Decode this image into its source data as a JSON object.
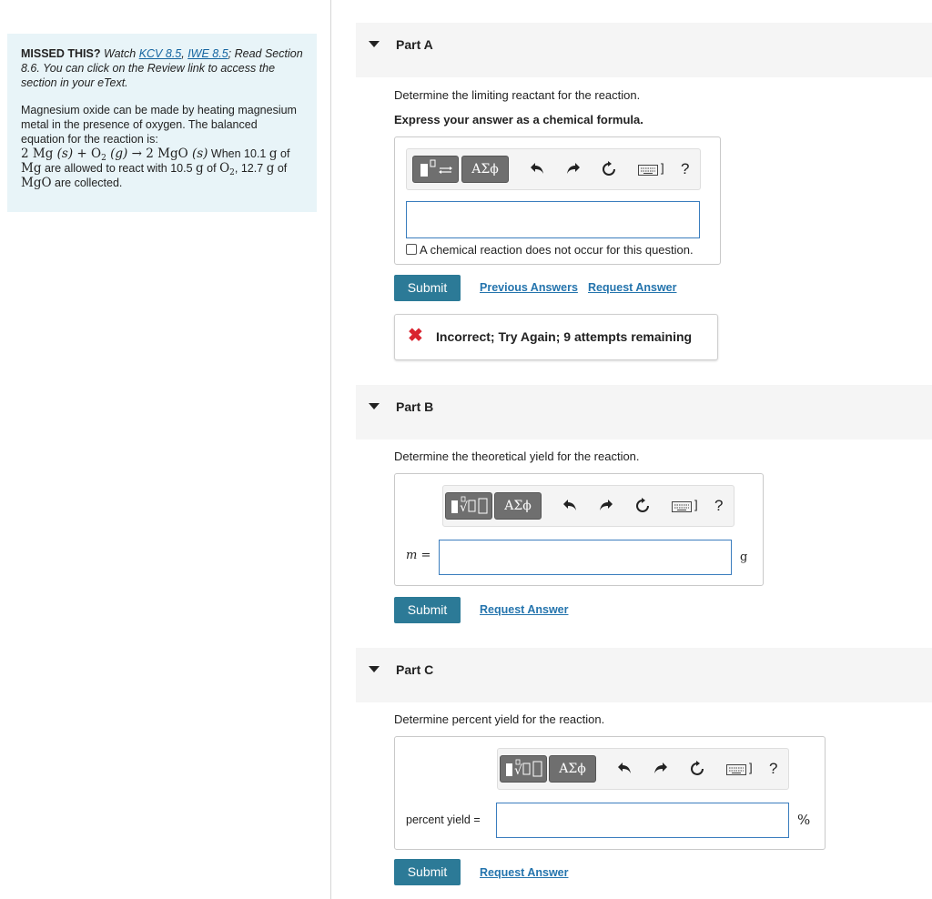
{
  "intro": {
    "missed_label": "MISSED THIS?",
    "missed_watch": "Watch",
    "kcv_link": "KCV 8.5",
    "iwe_link": "IWE 8.5",
    "missed_rest": "; Read Section 8.6. You can click on the Review link to access the section in your eText.",
    "problem_line1": "Magnesium oxide can be made by heating magnesium metal in the presence of oxygen. The balanced equation for the reaction is:",
    "eq_coef1": "2",
    "eq_mg": "Mg",
    "eq_s1": "(s)",
    "eq_plus": "+",
    "eq_o2": "O",
    "eq_g": "(g)",
    "eq_arrow": "→ 2",
    "eq_mgo": "MgO",
    "eq_s2": "(s)",
    "when_text": "When 10.1",
    "unit_g": "g",
    "of_text": "of",
    "allowed_text": "are allowed to react with 10.5",
    "yield_value": "12.7",
    "collected_text": "are collected."
  },
  "toolbar": {
    "greek_label": "ΑΣϕ",
    "help_label": "?",
    "kbd_bracket": "]"
  },
  "part_a": {
    "title": "Part A",
    "question": "Determine the limiting reactant for the reaction.",
    "instruction": "Express your answer as a chemical formula.",
    "input_value": "",
    "checkbox_label": "A chemical reaction does not occur for this question.",
    "submit_label": "Submit",
    "previous_answers_label": "Previous Answers",
    "request_answer_label": "Request Answer",
    "feedback_text": "Incorrect; Try Again; 9 attempts remaining"
  },
  "part_b": {
    "title": "Part B",
    "question": "Determine the theoretical yield for the reaction.",
    "input_label": "m =",
    "input_value": "",
    "unit": "g",
    "submit_label": "Submit",
    "request_answer_label": "Request Answer"
  },
  "part_c": {
    "title": "Part C",
    "question": "Determine percent yield for the reaction.",
    "input_label": "percent yield =",
    "input_value": "",
    "unit": "%",
    "submit_label": "Submit",
    "request_answer_label": "Request Answer"
  },
  "colors": {
    "intro_bg": "#e8f4f8",
    "submit_bg": "#2c7a97",
    "link": "#2474ad",
    "error": "#d9232f"
  }
}
